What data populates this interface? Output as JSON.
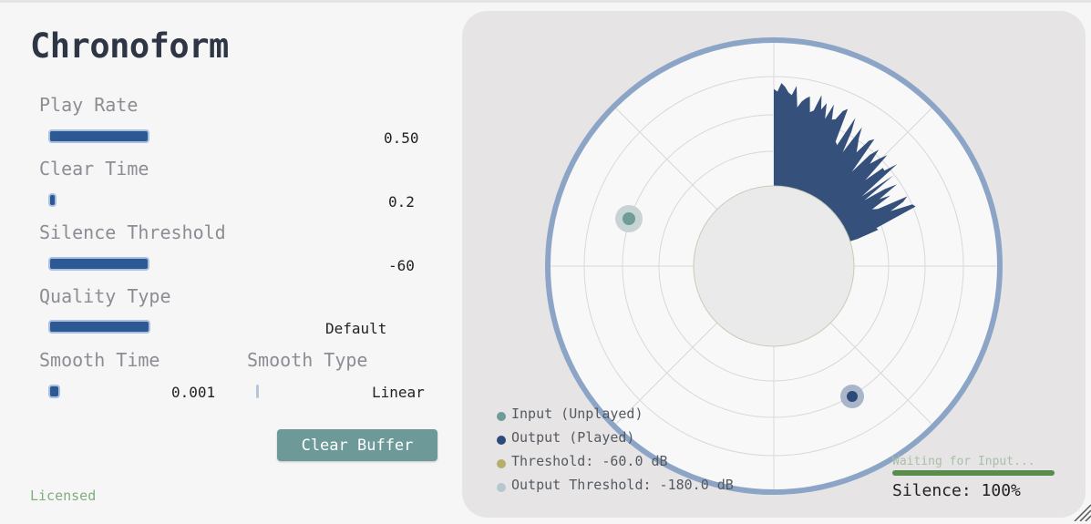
{
  "app": {
    "title": "Chronoform",
    "license_text": "Licensed"
  },
  "controls": {
    "play_rate": {
      "label": "Play Rate",
      "value": "0.50",
      "fill": 1.0
    },
    "clear_time": {
      "label": "Clear Time",
      "value": "0.2",
      "fill": 0.05
    },
    "silence_threshold": {
      "label": "Silence Threshold",
      "value": "-60",
      "fill": 1.0
    },
    "quality_type": {
      "label": "Quality Type",
      "value": "Default",
      "fill": 1.0
    },
    "smooth_time": {
      "label": "Smooth Time",
      "value": "0.001",
      "fill": 0.1
    },
    "smooth_type": {
      "label": "Smooth Type",
      "value": "Linear",
      "fill": 0.0
    },
    "clear_button": {
      "label": "Clear Buffer"
    }
  },
  "visualizer": {
    "legend": [
      {
        "label": "Input (Unplayed)",
        "color": "#6f9b99"
      },
      {
        "label": "Output (Played)",
        "color": "#2c4b7a"
      },
      {
        "label": "Threshold: -60.0 dB",
        "color": "#b3b06a"
      },
      {
        "label": "Output Threshold: -180.0 dB",
        "color": "#b5c8cf"
      }
    ],
    "status_text": "Waiting for Input...",
    "silence_text": "Silence: 100%",
    "colors": {
      "ring": "#8ca5c6",
      "wedge": "#34507b",
      "input_dot": "#6f9b99",
      "output_dot": "#2c4b7a"
    }
  }
}
